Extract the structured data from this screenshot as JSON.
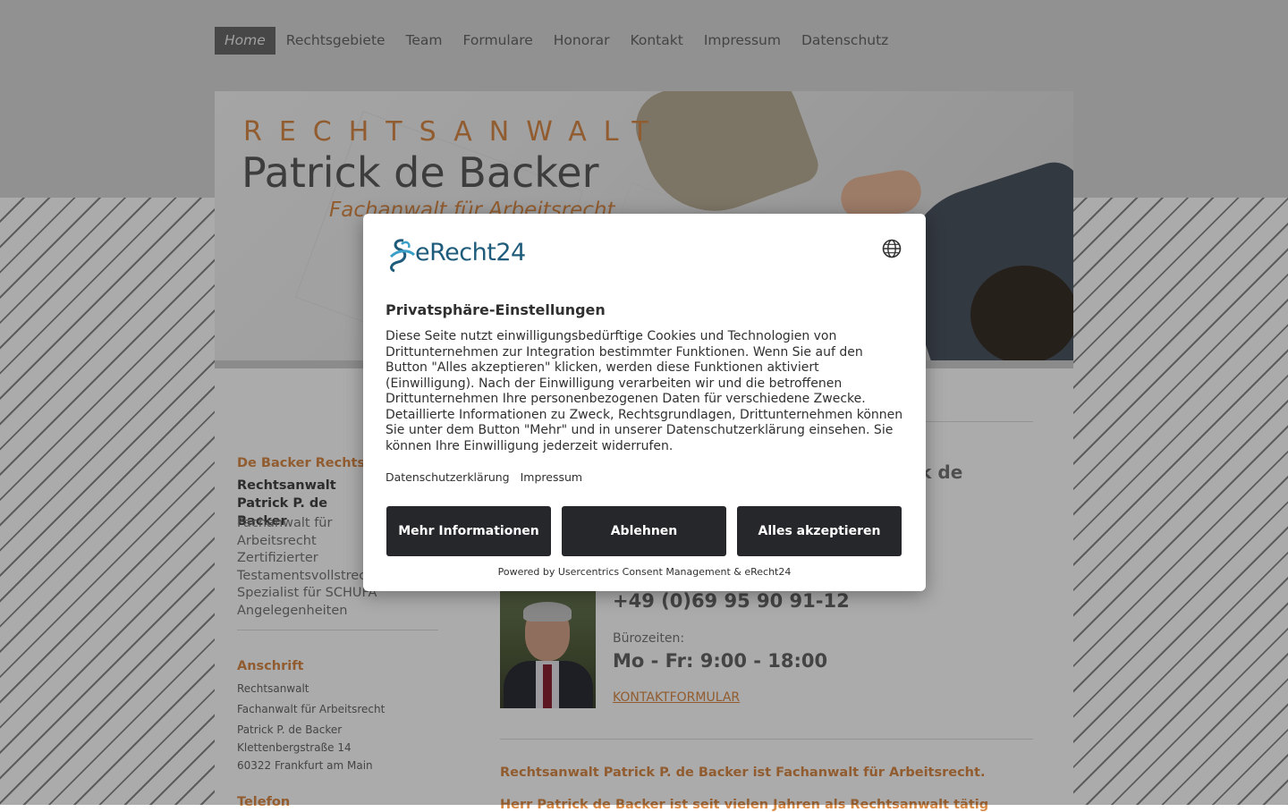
{
  "nav": {
    "items": [
      "Home",
      "Rechtsgebiete",
      "Team",
      "Formulare",
      "Honorar",
      "Kontakt",
      "Impressum",
      "Datenschutz"
    ]
  },
  "header": {
    "line1": "RECHTSANWALT",
    "line2": "Patrick de Backer",
    "line3": "Fachanwalt für Arbeitsrecht"
  },
  "sidebar": {
    "firm": "De Backer Rechtsanwälte",
    "name": "Rechtsanwalt Patrick P. de Backer",
    "desc": "Fachanwalt für Arbeitsrecht Zertifizierter Testamentsvollstrecker Spezialist für SCHUFA Angelegenheiten",
    "address_title": "Anschrift",
    "address_lines": [
      "Rechtsanwalt",
      "Fachanwalt für Arbeitsrecht",
      "Patrick P. de Backer",
      "Klettenbergstraße 14",
      "60322 Frankfurt am Main"
    ],
    "phone_title": "Telefon"
  },
  "main": {
    "title": "trick de",
    "phone": "+49 (0)69 95 90 91-12",
    "hours_label": "Bürozeiten:",
    "hours": "Mo - Fr: 9:00 - 18:00",
    "contact_link": "KONTAKTFORMULAR",
    "intro": "Rechtsanwalt Patrick P. de Backer ist Fachanwalt für Arbeitsrecht.",
    "intro2": "Herr Patrick de Backer ist seit vielen Jahren als Rechtsanwalt tätig"
  },
  "consent": {
    "logo_text": "eRecht24",
    "title": "Privatsphäre-Einstellungen",
    "body": "Diese Seite nutzt einwilligungsbedürftige Cookies und Technologien von Drittunternehmen zur Integration bestimmter Funktionen. Wenn Sie auf den Button \"Alles akzeptieren\" klicken, werden diese Funktionen aktiviert (Einwilligung). Nach der Einwilligung verarbeiten wir und die betroffenen Drittunternehmen Ihre personenbezogenen Daten für verschiedene Zwecke. Detaillierte Informationen zu Zweck, Rechtsgrundlagen, Drittunternehmen können Sie unter dem Button \"Mehr\" und in unserer Datenschutzerklärung einsehen. Sie können Ihre Einwilligung jederzeit widerrufen.",
    "link_privacy": "Datenschutzerklärung",
    "link_imprint": "Impressum",
    "btn_more": "Mehr Informationen",
    "btn_deny": "Ablehnen",
    "btn_accept": "Alles akzeptieren",
    "powered": "Powered by Usercentrics Consent Management & eRecht24"
  },
  "colors": {
    "accent": "#d98a47",
    "button": "#25272b",
    "logo": "#1f5b7a"
  }
}
